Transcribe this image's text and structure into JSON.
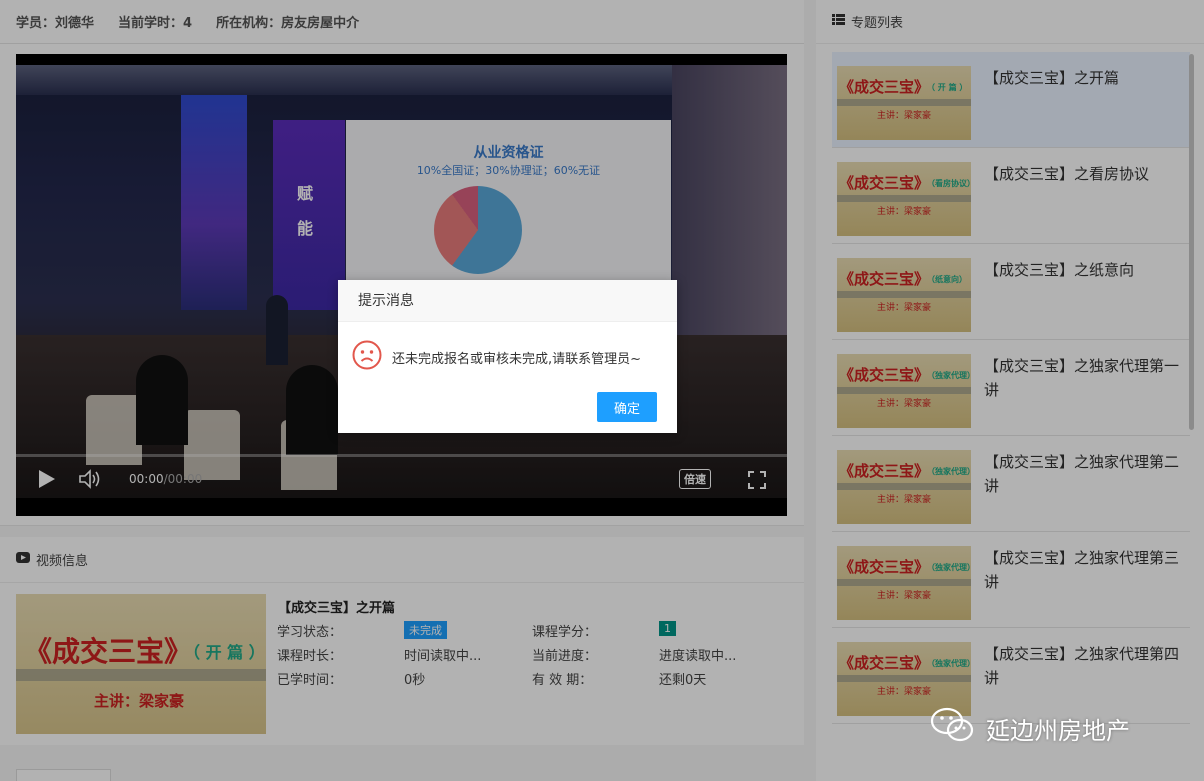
{
  "header": {
    "student_label": "学员：",
    "student_name": "刘德华",
    "hours_label": "当前学时：",
    "hours_value": "4",
    "org_label": "所在机构：",
    "org_value": "房友房屋中介"
  },
  "player": {
    "slide_title": "从业资格证",
    "slide_subtitle": "10%全国证；30%协理证；60%无证",
    "screen_text_1": "赋",
    "screen_text_2": "能",
    "time_current": "00:00",
    "time_separator": " / ",
    "time_total": "00:00",
    "speed_label": "倍速",
    "pie_shares": [
      60,
      30,
      10
    ]
  },
  "dialog": {
    "title": "提示消息",
    "message": "还未完成报名或审核未完成,请联系管理员~",
    "ok_label": "确定"
  },
  "video_info": {
    "section_title": "视频信息",
    "course_title": "【成交三宝】之开篇",
    "thumb_title": "《成交三宝》",
    "thumb_tag": "（ 开 篇 ）",
    "thumb_speaker": "主讲：梁家豪",
    "fields": [
      {
        "label": "学习状态：",
        "value": "未完成"
      },
      {
        "label": "课程学分：",
        "value": "1"
      },
      {
        "label": "课程时长：",
        "value": "时间读取中..."
      },
      {
        "label": "当前进度：",
        "value": "进度读取中..."
      },
      {
        "label": "已学时间：",
        "value": "0秒"
      },
      {
        "label": "有 效 期：",
        "value": "还剩0天"
      }
    ]
  },
  "sidebar": {
    "title": "专题列表",
    "items": [
      {
        "title": "【成交三宝】之开篇",
        "thumb_tag": "（ 开 篇 ）"
      },
      {
        "title": "【成交三宝】之看房协议",
        "thumb_tag": "（看房协议）"
      },
      {
        "title": "【成交三宝】之纸意向",
        "thumb_tag": "（纸意向）"
      },
      {
        "title": "【成交三宝】之独家代理第一讲",
        "thumb_tag": "（独家代理）"
      },
      {
        "title": "【成交三宝】之独家代理第二讲",
        "thumb_tag": "（独家代理）"
      },
      {
        "title": "【成交三宝】之独家代理第三讲",
        "thumb_tag": "（独家代理）"
      },
      {
        "title": "【成交三宝】之独家代理第四讲",
        "thumb_tag": "（独家代理）"
      }
    ],
    "thumb_title": "《成交三宝》",
    "thumb_speaker": "主讲：梁家豪"
  },
  "watermark": {
    "text": "延边州房地产"
  },
  "colors": {
    "primary": "#1e9fff",
    "credit": "#009688",
    "thumb_red": "#cc2222"
  }
}
